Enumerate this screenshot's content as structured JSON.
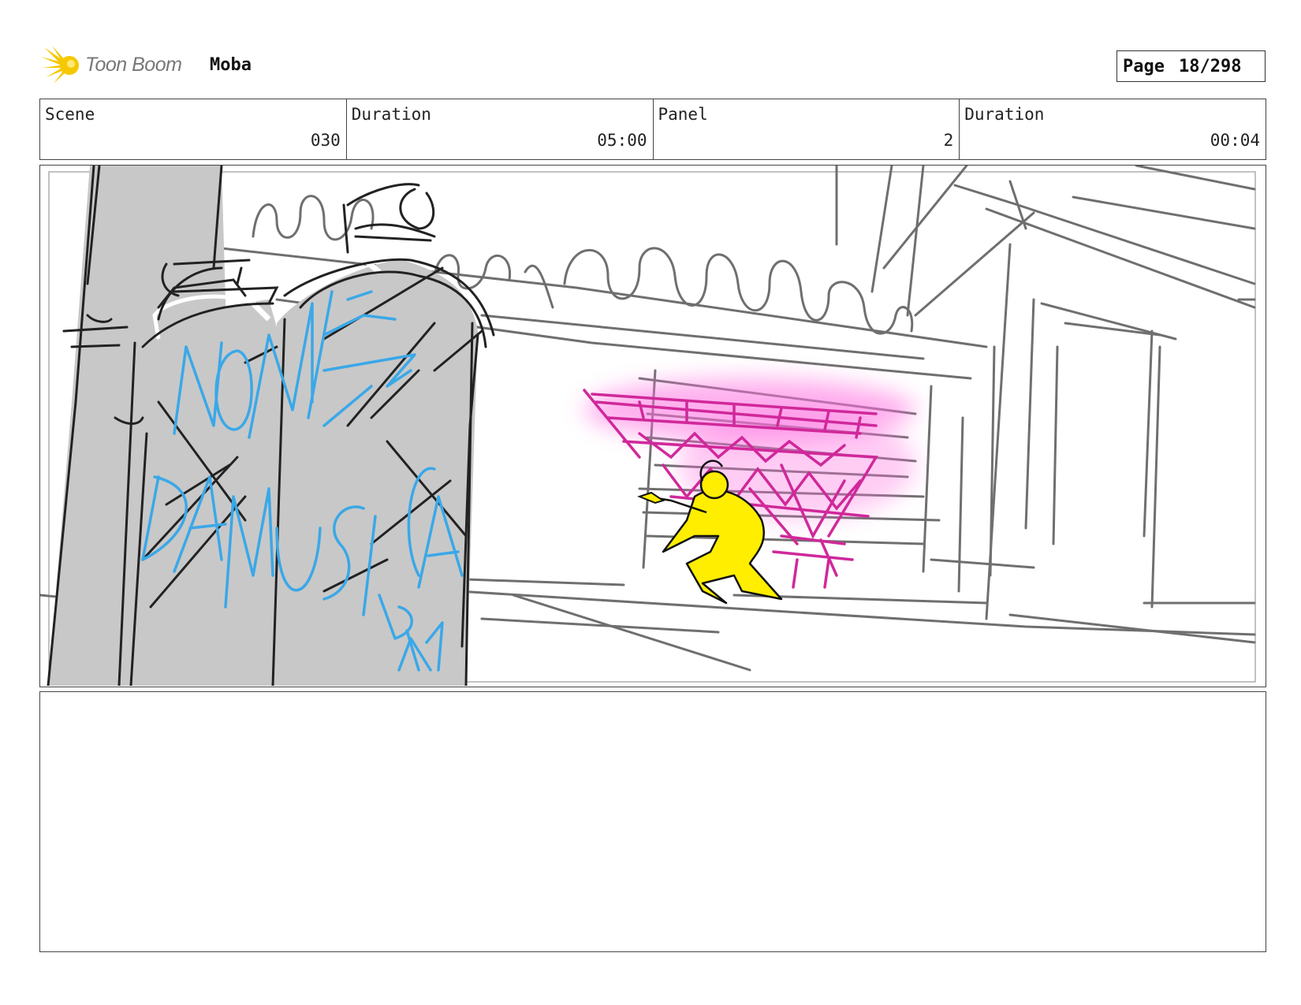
{
  "header": {
    "logo_text": "Toon Boom",
    "project_title": "Moba",
    "page_label": "Page",
    "page_value": "18/298"
  },
  "info": {
    "scene_label": "Scene",
    "scene_value": "030",
    "scene_duration_label": "Duration",
    "scene_duration_value": "05:00",
    "panel_label": "Panel",
    "panel_value": "2",
    "panel_duration_label": "Duration",
    "panel_duration_value": "00:04"
  },
  "panel_sketch": {
    "graffiti_lines": [
      "NOME",
      "DA MUSICA",
      "BY"
    ],
    "colors": {
      "sketch": "#6f6f6f",
      "ink": "#222222",
      "canister_fill": "#c8c8c8",
      "graffiti": "#3aa8e8",
      "sign": "#d0289a",
      "sign_glow": "#ff6ee0",
      "character": "#ffee00"
    }
  },
  "notes": {
    "text": ""
  }
}
